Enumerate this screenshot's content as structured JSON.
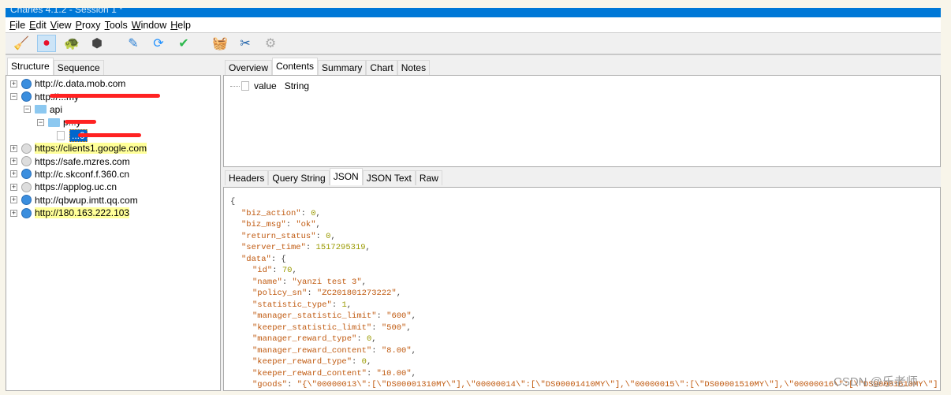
{
  "window": {
    "title": "Charles 4.1.2 - Session 1 *"
  },
  "menu": [
    "File",
    "Edit",
    "View",
    "Proxy",
    "Tools",
    "Window",
    "Help"
  ],
  "toolbar": [
    {
      "icon": "broom-icon",
      "glyph": "🧹"
    },
    {
      "icon": "record-icon",
      "glyph": "●",
      "active": true
    },
    {
      "icon": "throttle-turtle-icon",
      "glyph": "🐢"
    },
    {
      "icon": "breakpoint-icon",
      "glyph": "⬢"
    },
    {
      "icon": "compose-pen-icon",
      "glyph": "✎"
    },
    {
      "icon": "repeat-icon",
      "glyph": "⟳"
    },
    {
      "icon": "validate-check-icon",
      "glyph": "✔"
    },
    {
      "icon": "basket-icon",
      "glyph": "🧺"
    },
    {
      "icon": "tools-icon",
      "glyph": "✂"
    },
    {
      "icon": "settings-gear-icon",
      "glyph": "⚙"
    }
  ],
  "left_tabs": [
    "Structure",
    "Sequence"
  ],
  "tree": [
    {
      "label": "http://c.data.mob.com",
      "type": "http",
      "expanded": false
    },
    {
      "label": "http://...my",
      "type": "http",
      "expanded": true,
      "redacted": true
    },
    {
      "label": "api",
      "type": "folder",
      "level": 1
    },
    {
      "label": "p...y",
      "type": "folder",
      "level": 2,
      "redacted": true
    },
    {
      "label": "...0",
      "type": "file",
      "level": 3,
      "selected": true,
      "redacted": true
    },
    {
      "label": "https://clients1.google.com",
      "type": "https",
      "highlight": true
    },
    {
      "label": "https://safe.mzres.com",
      "type": "https"
    },
    {
      "label": "http://c.skconf.f.360.cn",
      "type": "http"
    },
    {
      "label": "https://applog.uc.cn",
      "type": "https"
    },
    {
      "label": "http://qbwup.imtt.qq.com",
      "type": "http"
    },
    {
      "label": "http://180.163.222.103",
      "type": "http",
      "highlight": true
    }
  ],
  "top_tabs": [
    "Overview",
    "Contents",
    "Summary",
    "Chart",
    "Notes"
  ],
  "top_selected": "Contents",
  "contents": {
    "name": "value",
    "type": "String"
  },
  "bottom_tabs": [
    "Headers",
    "Query String",
    "JSON",
    "JSON Text",
    "Raw"
  ],
  "bottom_selected": "JSON",
  "json_lines": [
    {
      "i": 0,
      "t": "{"
    },
    {
      "i": 1,
      "k": "biz_action",
      "v": "0",
      "n": true
    },
    {
      "i": 1,
      "k": "biz_msg",
      "v": "\"ok\""
    },
    {
      "i": 1,
      "k": "return_status",
      "v": "0",
      "n": true
    },
    {
      "i": 1,
      "k": "server_time",
      "v": "1517295319",
      "n": true
    },
    {
      "i": 1,
      "k": "data",
      "v": "{",
      "open": true
    },
    {
      "i": 2,
      "k": "id",
      "v": "70",
      "n": true
    },
    {
      "i": 2,
      "k": "name",
      "v": "\"yanzi test 3\""
    },
    {
      "i": 2,
      "k": "policy_sn",
      "v": "\"ZC201801273222\""
    },
    {
      "i": 2,
      "k": "statistic_type",
      "v": "1",
      "n": true
    },
    {
      "i": 2,
      "k": "manager_statistic_limit",
      "v": "\"600\""
    },
    {
      "i": 2,
      "k": "keeper_statistic_limit",
      "v": "\"500\""
    },
    {
      "i": 2,
      "k": "manager_reward_type",
      "v": "0",
      "n": true
    },
    {
      "i": 2,
      "k": "manager_reward_content",
      "v": "\"8.00\""
    },
    {
      "i": 2,
      "k": "keeper_reward_type",
      "v": "0",
      "n": true
    },
    {
      "i": 2,
      "k": "keeper_reward_content",
      "v": "\"10.00\""
    },
    {
      "i": 2,
      "k": "goods",
      "v": "\"{\\\"00000013\\\":[\\\"DS00001310MY\\\"],\\\"00000014\\\":[\\\"DS00001410MY\\\"],\\\"00000015\\\":[\\\"DS00001510MY\\\"],\\\"00000016\\\":[\\\"DS00001610MY\\\"]",
      "last": true
    }
  ],
  "watermark": "CSDN @乐老师"
}
